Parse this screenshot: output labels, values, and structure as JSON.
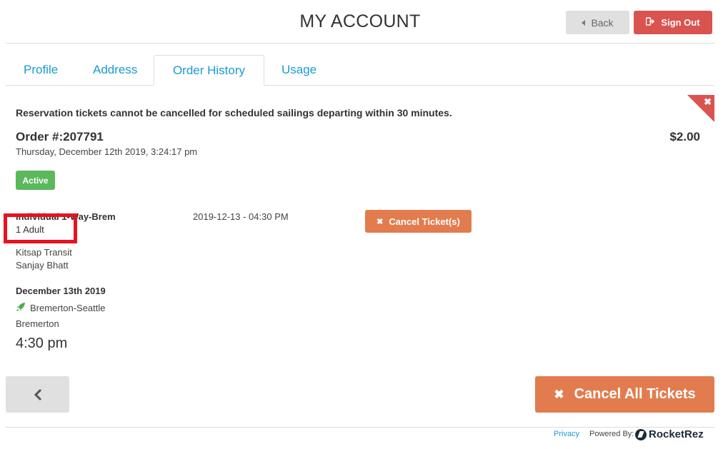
{
  "header": {
    "title": "MY ACCOUNT",
    "back_label": "Back",
    "signout_label": "Sign Out"
  },
  "tabs": [
    {
      "label": "Profile",
      "active": false
    },
    {
      "label": "Address",
      "active": false
    },
    {
      "label": "Order History",
      "active": true
    },
    {
      "label": "Usage",
      "active": false
    }
  ],
  "notice": "Reservation tickets cannot be cancelled for scheduled sailings departing within 30 minutes.",
  "order": {
    "number": "Order #:207791",
    "date": "Thursday, December 12th 2019, 3:24:17 pm",
    "total": "$2.00",
    "status": "Active",
    "status_color": "#5cb85c",
    "ticket": {
      "name": "Individual 1-Way-Brem",
      "quantity": "1 Adult",
      "datetime": "2019-12-13 - 04:30 PM",
      "cancel_label": "Cancel Ticket(s)",
      "operator": "Kitsap Transit",
      "passenger": "Sanjay Bhatt"
    },
    "sailing": {
      "date": "December 13th 2019",
      "route": "Bremerton-Seattle",
      "terminal": "Bremerton",
      "time": "4:30 pm"
    }
  },
  "actions": {
    "prev_icon": "chevron-left-icon",
    "cancel_all_label": "Cancel All Tickets"
  },
  "footer": {
    "privacy_label": "Privacy",
    "powered_by_label": "Powered By:",
    "brand": "RocketRez"
  },
  "colors": {
    "accent_blue": "#1a9bd0",
    "danger_red": "#d9534f",
    "cancel_orange": "#e27c4f",
    "highlight_red": "#e8111f"
  }
}
